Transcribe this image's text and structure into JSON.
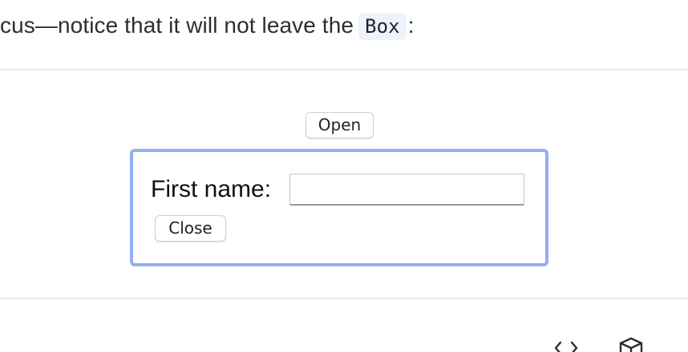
{
  "intro": {
    "text_before": "cus—notice that it will not leave the",
    "code": "Box",
    "text_after": ":"
  },
  "demo": {
    "open_label": "Open",
    "first_name_label": "First name:",
    "first_name_value": "",
    "first_name_placeholder": "",
    "close_label": "Close"
  },
  "colors": {
    "focus_border": "#93aef0",
    "code_background": "#eef3fb"
  },
  "icons": {
    "code": "code-icon",
    "sandbox": "sandbox-icon"
  }
}
